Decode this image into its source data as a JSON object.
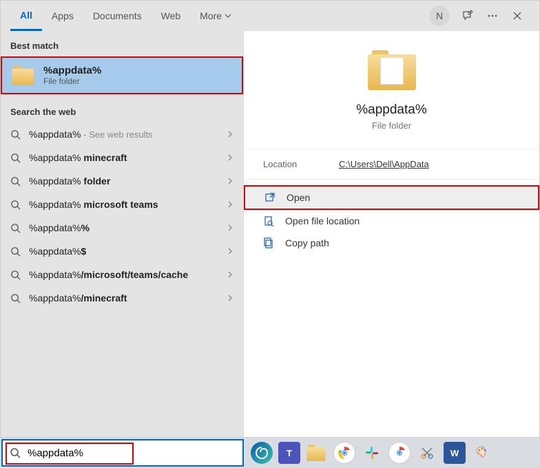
{
  "tabs": {
    "all": "All",
    "apps": "Apps",
    "documents": "Documents",
    "web": "Web",
    "more": "More"
  },
  "avatar_initial": "N",
  "left": {
    "best_match_hdr": "Best match",
    "best_match": {
      "title": "%appdata%",
      "subtitle": "File folder"
    },
    "search_web_hdr": "Search the web",
    "web_items": [
      {
        "prefix": "%appdata%",
        "suffix": "",
        "hint": " - See web results"
      },
      {
        "prefix": "%appdata%",
        "suffix": " minecraft",
        "hint": ""
      },
      {
        "prefix": "%appdata%",
        "suffix": " folder",
        "hint": ""
      },
      {
        "prefix": "%appdata%",
        "suffix": " microsoft teams",
        "hint": ""
      },
      {
        "prefix": "%appdata%",
        "suffix": "%",
        "hint": ""
      },
      {
        "prefix": "%appdata%",
        "suffix": "$",
        "hint": ""
      },
      {
        "prefix": "%appdata%",
        "suffix": "/microsoft/teams/cache",
        "hint": ""
      },
      {
        "prefix": "%appdata%",
        "suffix": "/minecraft",
        "hint": ""
      }
    ]
  },
  "right": {
    "title": "%appdata%",
    "subtitle": "File folder",
    "location_label": "Location",
    "location_value": "C:\\Users\\Dell\\AppData",
    "actions": [
      {
        "label": "Open",
        "icon": "open-icon"
      },
      {
        "label": "Open file location",
        "icon": "location-icon"
      },
      {
        "label": "Copy path",
        "icon": "copy-icon"
      }
    ]
  },
  "search_value": "%appdata%"
}
